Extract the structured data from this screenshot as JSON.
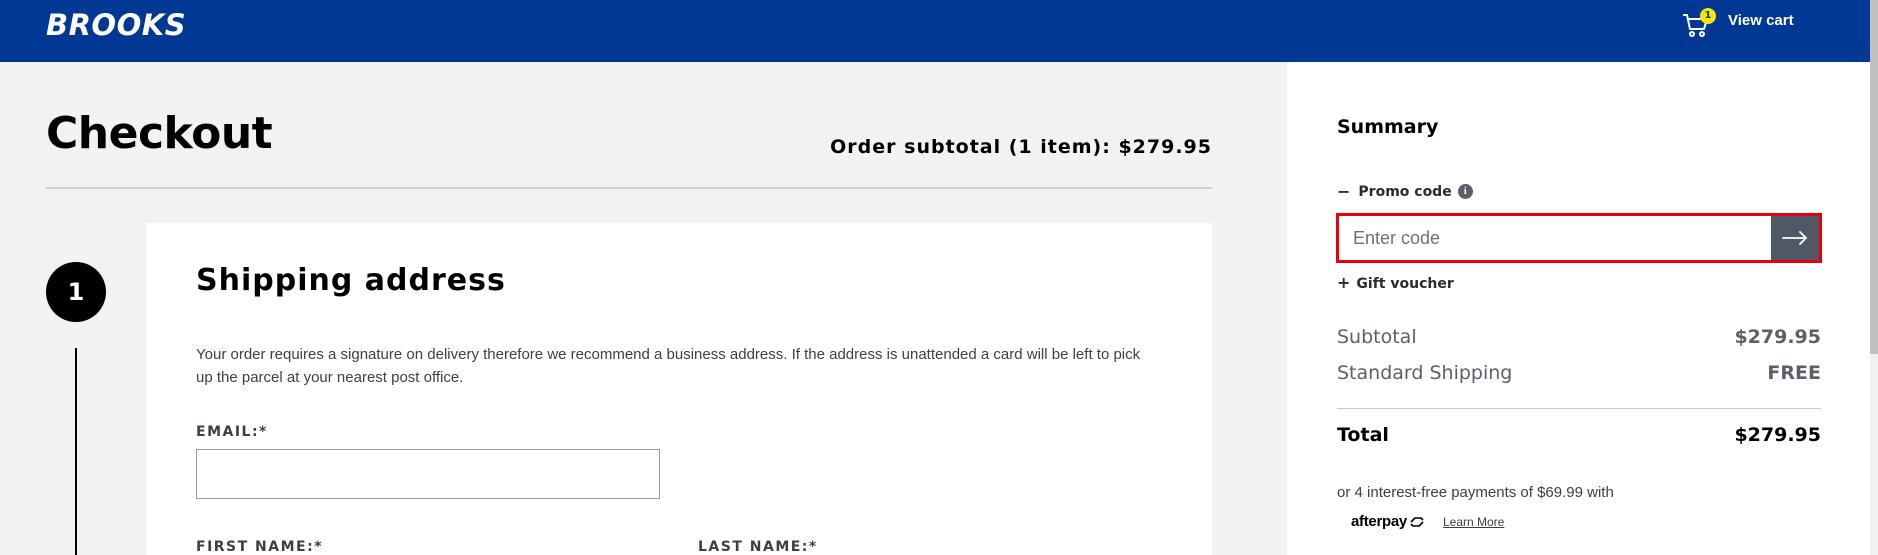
{
  "header": {
    "logo": "BROOKS",
    "cart_count": "1",
    "view_cart_label": "View cart",
    "bg_color": "#003893"
  },
  "main": {
    "title": "Checkout",
    "order_subtotal": "Order subtotal (1 item): $279.95",
    "step_number": "1",
    "shipping": {
      "title": "Shipping address",
      "description": "Your order requires a signature on delivery therefore we recommend a business address. If the address is unattended a card will be left to pick up the parcel at your nearest post office.",
      "email_label": "EMAIL:*",
      "email_value": "",
      "first_name_label": "FIRST NAME:*",
      "last_name_label": "LAST NAME:*"
    }
  },
  "summary": {
    "title": "Summary",
    "promo_label": "Promo code",
    "promo_placeholder": "Enter code",
    "gift_label": "Gift voucher",
    "rows": [
      {
        "label": "Subtotal",
        "value": "$279.95"
      },
      {
        "label": "Standard Shipping",
        "value": "FREE"
      }
    ],
    "total_label": "Total",
    "total_value": "$279.95",
    "afterpay_text": "or 4 interest-free payments of $69.99 with",
    "afterpay_logo": "afterpay",
    "learn_more": "Learn More",
    "highlight_color": "#e8000b"
  }
}
